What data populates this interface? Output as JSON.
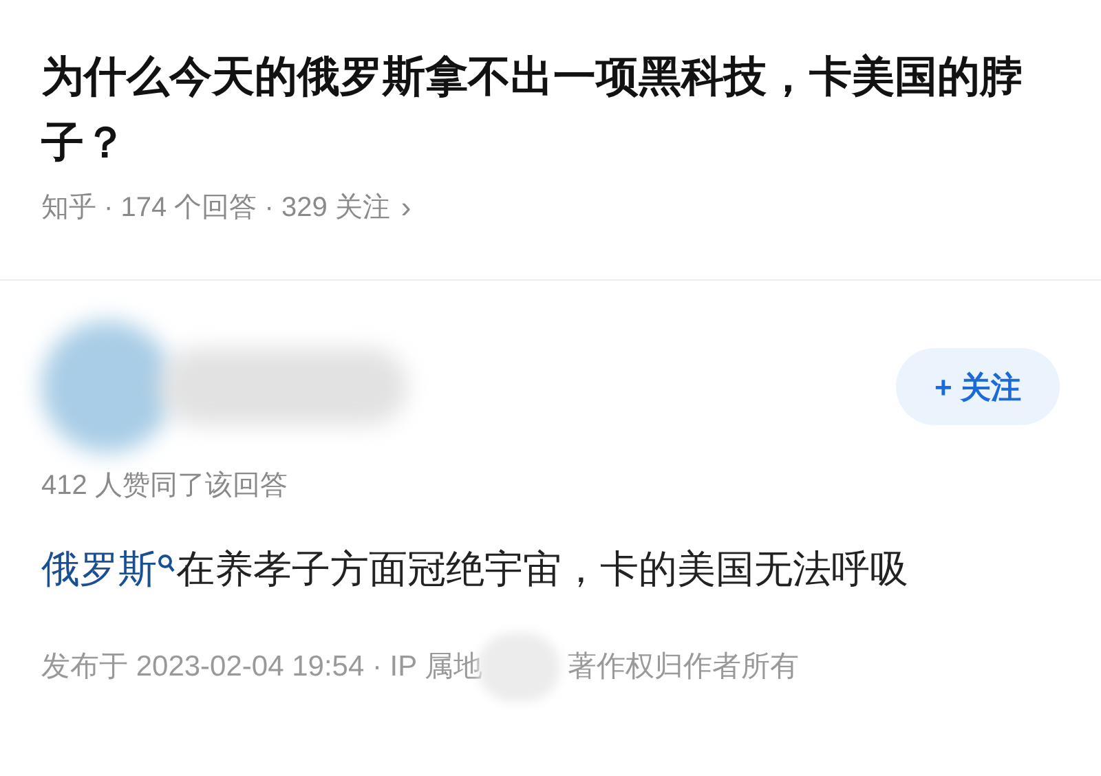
{
  "question": {
    "title": "为什么今天的俄罗斯拿不出一项黑科技，卡美国的脖子？",
    "meta": "知乎 · 174 个回答 · 329 关注",
    "chevron": "›"
  },
  "answer": {
    "follow_button": "+ 关注",
    "followed": false,
    "upvotes": "412 人赞同了该回答",
    "link": "俄罗斯",
    "body": "在养孝子方面冠绝宇宙，卡的美国无法呼吸",
    "published": "发布于 2023-02-04 19:54 · IP 属地",
    "copyright": "著作权归作者所有"
  }
}
